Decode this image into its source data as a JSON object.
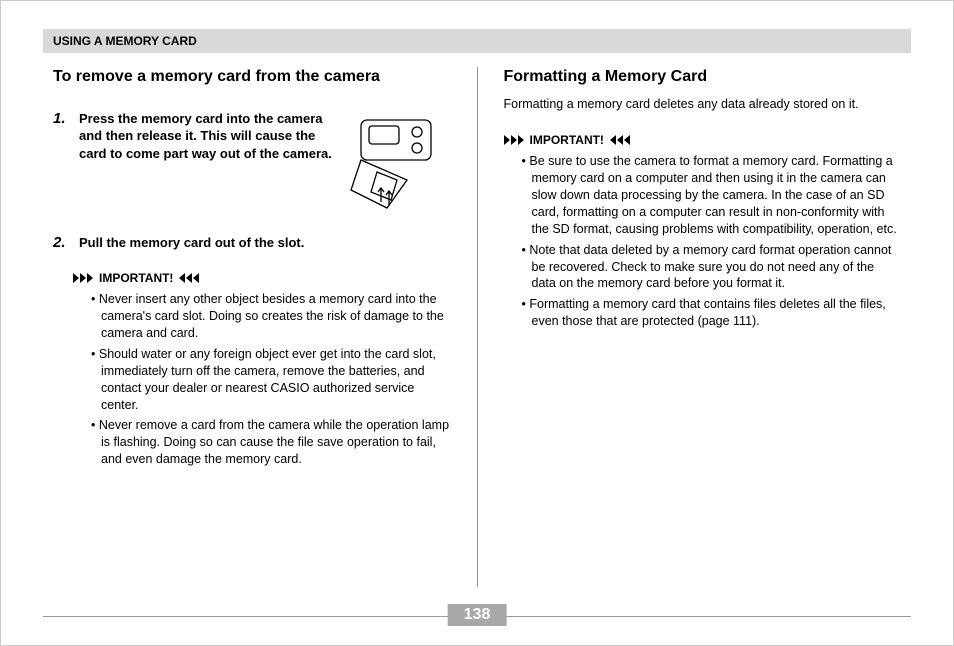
{
  "header": "USING A MEMORY CARD",
  "page_number": "138",
  "left": {
    "heading": "To remove a memory card from the camera",
    "steps": [
      {
        "num": "1.",
        "text": "Press the memory card into the camera and then release it. This will cause the card to come part way out of the camera."
      },
      {
        "num": "2.",
        "text": "Pull the memory card out of the slot."
      }
    ],
    "important_label": "IMPORTANT!",
    "important_items": [
      "Never insert any other object besides a memory card into the camera's card slot. Doing so creates the risk of damage to the camera and card.",
      "Should water or any foreign object ever get into the card slot, immediately turn off the camera, remove the batteries, and contact your dealer or nearest CASIO authorized service center.",
      "Never remove a card from the camera while the operation lamp is flashing. Doing so can cause the file save operation to fail, and even damage the memory card."
    ]
  },
  "right": {
    "heading": "Formatting a Memory Card",
    "intro": "Formatting a memory card deletes any data already stored on it.",
    "important_label": "IMPORTANT!",
    "important_items": [
      "Be sure to use the camera to format a memory card. Formatting a memory card on a computer and then using it in the camera can slow down data processing by the camera. In the case of an SD card, formatting on a computer can result in non-conformity with the SD format, causing problems with compatibility, operation, etc.",
      "Note that data deleted by a memory card format operation cannot be recovered. Check to make sure you do not need any of the data on the memory card before you format it.",
      "Formatting a memory card that contains files deletes all the files, even those that are protected (page 111)."
    ]
  }
}
